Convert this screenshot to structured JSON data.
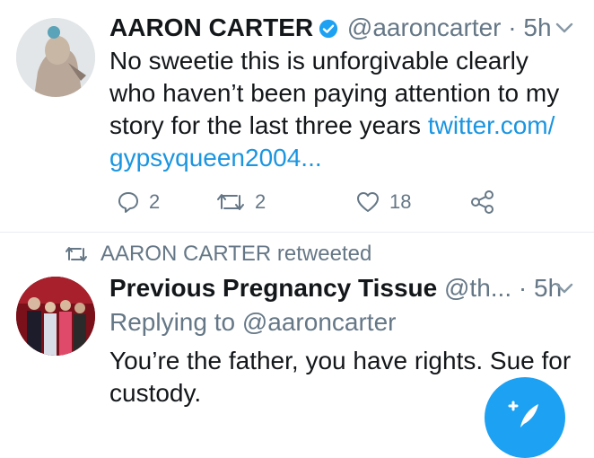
{
  "tweet1": {
    "name": "AARON CARTER",
    "handle": "@aaroncarter",
    "separator": "·",
    "time": "5h",
    "text": "No sweetie this is unforgivable clearly who haven’t been paying attention to my story for the last three years",
    "link": "twitter.com/ gypsyqueen2004...",
    "actions": {
      "reply_count": "2",
      "retweet_count": "2",
      "like_count": "18"
    }
  },
  "retweet_banner": {
    "label": "AARON CARTER retweeted"
  },
  "tweet2": {
    "name": "Previous Pregnancy Tissue",
    "handle": "@th...",
    "separator": "·",
    "time": "5h",
    "replying_to": "Replying to @aaroncarter",
    "text": "You’re the father, you have rights. Sue for custody."
  },
  "icons": {
    "verified": "verified-badge-icon",
    "chevron": "chevron-down-icon",
    "reply": "reply-icon",
    "retweet": "retweet-icon",
    "like": "heart-icon",
    "share": "share-icon",
    "compose": "compose-tweet-icon"
  },
  "colors": {
    "accent": "#1da1f2",
    "link": "#1b95e0",
    "muted": "#657786",
    "text": "#14171a"
  }
}
